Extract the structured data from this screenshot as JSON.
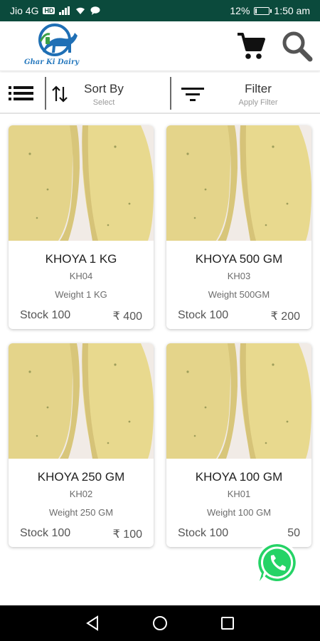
{
  "status_bar": {
    "carrier": "Jio 4G",
    "hd_label": "HD",
    "battery_percent": "12%",
    "battery_level": 0.12,
    "time": "1:50 am"
  },
  "header": {
    "logo_text": "Ghar Ki Dairy",
    "cart_icon": "shopping-cart-icon",
    "search_icon": "search-icon"
  },
  "toolbar": {
    "menu_icon": "list-menu-icon",
    "sort_title": "Sort By",
    "sort_subtitle": "Select",
    "filter_title": "Filter",
    "filter_subtitle": "Apply Filter"
  },
  "products": [
    {
      "name": "KHOYA 1 KG",
      "code": "KH04",
      "weight": "Weight 1 KG",
      "stock": "Stock  100",
      "price": "₹ 400"
    },
    {
      "name": "KHOYA 500 GM",
      "code": "KH03",
      "weight": "Weight 500GM",
      "stock": "Stock  100",
      "price": "₹ 200"
    },
    {
      "name": "KHOYA 250 GM",
      "code": "KH02",
      "weight": "Weight 250 GM",
      "stock": "Stock  100",
      "price": "₹ 100"
    },
    {
      "name": "KHOYA 100 GM",
      "code": "KH01",
      "weight": "Weight 100 GM",
      "stock": "Stock  100",
      "price": "50"
    }
  ],
  "floating": {
    "whatsapp_icon": "whatsapp-icon"
  },
  "colors": {
    "status_bar": "#0b4a3c",
    "whatsapp_green": "#25d366",
    "khoya_yellow": "#e6d88a"
  }
}
